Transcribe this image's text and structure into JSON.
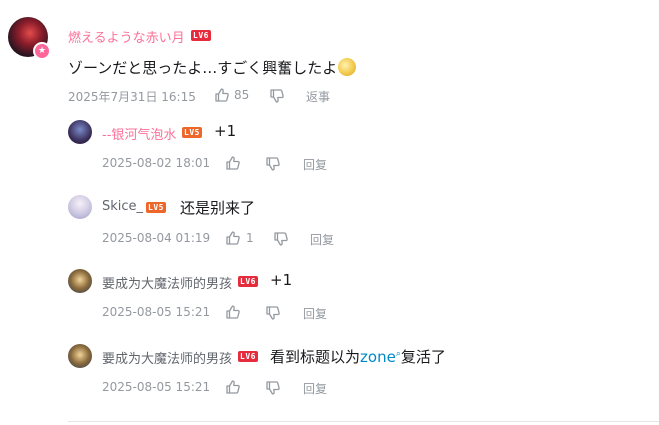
{
  "main_comment": {
    "username": "燃えるような赤い月",
    "level": "LV6",
    "text": "ゾーンだと思ったよ…すごく興奮したよ",
    "emoji": "face-emoji",
    "date": "2025年7月31日 16:15",
    "likes": "85",
    "reply_label": "返事"
  },
  "replies": [
    {
      "username": "--银河气泡水",
      "level": "LV5",
      "text": "+1",
      "date": "2025-08-02 18:01",
      "likes": "",
      "reply_label": "回复"
    },
    {
      "username": "Skice_",
      "level": "LV5",
      "text": "还是别来了",
      "date": "2025-08-04 01:19",
      "likes": "1",
      "reply_label": "回复"
    },
    {
      "username": "要成为大魔法师的男孩",
      "level": "LV6",
      "text": "+1",
      "date": "2025-08-05 15:21",
      "likes": "",
      "reply_label": "回复"
    },
    {
      "username": "要成为大魔法师的男孩",
      "level": "LV6",
      "text_before": "看到标题以为",
      "keyword": "zone",
      "text_after": "复活了",
      "date": "2025-08-05 15:21",
      "likes": "",
      "reply_label": "回复"
    }
  ],
  "colors": {
    "username_pink": "#fb7299",
    "meta_gray": "#9499a0",
    "keyword_blue": "#008ac5",
    "lv6_red": "#e52b3c",
    "lv5_orange": "#ee672a"
  },
  "icons": {
    "like": "thumb-up-icon",
    "dislike": "thumb-down-icon",
    "search": "search-icon"
  }
}
